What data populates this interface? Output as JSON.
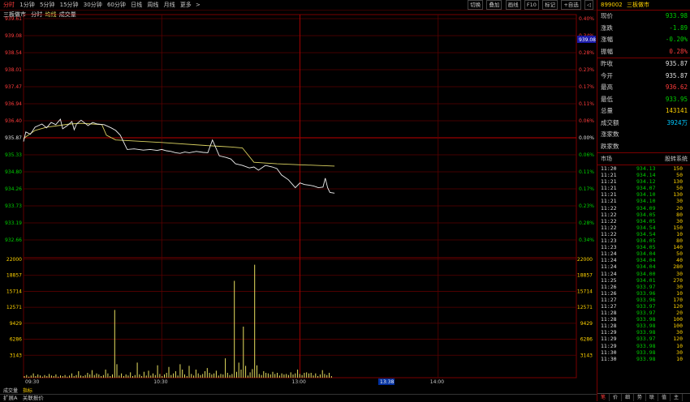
{
  "topbar": {
    "timeframes": [
      "分时",
      "1分钟",
      "5分钟",
      "15分钟",
      "30分钟",
      "60分钟",
      "日线",
      "周线",
      "月线",
      "更多"
    ],
    "active_index": 0,
    "more_arrow": ">",
    "tools": [
      "切换",
      "叠加",
      "画线",
      "F10",
      "标记",
      "+自选",
      "◁"
    ]
  },
  "subbar": {
    "name": "三板做市",
    "mode": "分时",
    "avg_label": "均线",
    "vol_label": "成交量"
  },
  "chart_data": {
    "type": "line",
    "prev_close": 935.87,
    "price_ticks": [
      "939.61",
      "939.08",
      "938.54",
      "938.01",
      "937.47",
      "936.94",
      "936.40",
      "935.87",
      "935.33",
      "934.80",
      "934.26",
      "933.73",
      "933.19",
      "932.66"
    ],
    "pct_ticks": [
      "0.40%",
      "0.34%",
      "0.28%",
      "0.23%",
      "0.17%",
      "0.11%",
      "0.06%",
      "0.00%",
      "0.06%",
      "0.11%",
      "0.17%",
      "0.23%",
      "0.28%",
      "0.34%"
    ],
    "price_ylim": [
      932.66,
      939.61
    ],
    "price_x": [
      0,
      1,
      3,
      5,
      8,
      10,
      12,
      14,
      16,
      17,
      19,
      21,
      22,
      23,
      25,
      28,
      30,
      32,
      35,
      38,
      40,
      42,
      45,
      48,
      50,
      52,
      55,
      58,
      60,
      62,
      64,
      66,
      68,
      70,
      72,
      75,
      78,
      80,
      82,
      85,
      88,
      90,
      92,
      95,
      98,
      100,
      102,
      105,
      108,
      110,
      112,
      115,
      118,
      120,
      122,
      124,
      126,
      128,
      130,
      131,
      132,
      133,
      135
    ],
    "price": [
      935.75,
      936.05,
      935.98,
      936.2,
      936.3,
      936.18,
      936.35,
      936.28,
      936.45,
      936.15,
      936.25,
      936.38,
      936.12,
      936.3,
      936.42,
      936.25,
      936.35,
      936.3,
      936.28,
      936.18,
      936.1,
      935.95,
      935.5,
      935.52,
      935.5,
      935.48,
      935.5,
      935.47,
      935.5,
      935.46,
      935.44,
      935.4,
      935.38,
      935.42,
      935.4,
      935.44,
      935.41,
      935.4,
      935.8,
      935.3,
      935.25,
      935.2,
      935.05,
      935.0,
      934.92,
      934.95,
      934.85,
      935.0,
      934.95,
      934.9,
      934.7,
      934.55,
      934.3,
      934.45,
      934.4,
      934.38,
      934.35,
      934.3,
      934.32,
      934.6,
      934.3,
      934.15,
      934.13
    ],
    "avg_x": [
      0,
      5,
      10,
      15,
      20,
      25,
      30,
      34,
      36,
      40,
      60,
      80,
      85,
      90,
      95,
      100,
      110,
      120,
      135
    ],
    "avg": [
      935.85,
      936.1,
      936.2,
      936.25,
      936.3,
      936.32,
      936.3,
      936.28,
      935.95,
      935.8,
      935.72,
      935.62,
      935.6,
      935.58,
      935.55,
      935.1,
      935.05,
      935.02,
      934.98
    ],
    "vol_ticks": [
      "22000",
      "18857",
      "15714",
      "12571",
      "9429",
      "6286",
      "3143"
    ],
    "vol_ylim": [
      0,
      22000
    ],
    "volume": [
      300,
      500,
      200,
      400,
      800,
      300,
      600,
      400,
      200,
      500,
      300,
      700,
      400,
      300,
      600,
      200,
      400,
      300,
      500,
      200,
      400,
      800,
      300,
      500,
      1200,
      400,
      300,
      500,
      900,
      600,
      1400,
      500,
      800,
      600,
      300,
      500,
      1500,
      800,
      300,
      600,
      12600,
      2500,
      400,
      800,
      300,
      600,
      400,
      1000,
      300,
      500,
      2800,
      600,
      300,
      1100,
      400,
      1300,
      400,
      800,
      500,
      2300,
      700,
      300,
      600,
      900,
      2000,
      500,
      800,
      1200,
      400,
      2500,
      1500,
      600,
      300,
      2200,
      700,
      400,
      1500,
      800,
      500,
      700,
      1200,
      1800,
      900,
      600,
      800,
      1300,
      400,
      700,
      600,
      3600,
      900,
      500,
      700,
      18000,
      1100,
      2800,
      1500,
      9500,
      2200,
      400,
      1000,
      1600,
      21000,
      2300,
      700,
      500,
      1200,
      900,
      800,
      600,
      1100,
      700,
      900,
      400,
      800,
      600,
      700,
      500,
      1000,
      600,
      800,
      1500,
      700,
      500,
      900,
      1000,
      800,
      900,
      400,
      800,
      300,
      600,
      1400,
      700,
      500,
      900,
      300
    ],
    "x_labels": [
      "09:30",
      "10:30",
      "13:00",
      "13:38",
      "14:00"
    ],
    "vol_label": "成交量",
    "indicator_label": "指标"
  },
  "right": {
    "code": "899002",
    "name": "三板做市",
    "rows1": [
      {
        "label": "现价",
        "value": "933.98",
        "color": "#00d000"
      },
      {
        "label": "涨跌",
        "value": "-1.89",
        "color": "#00d000"
      },
      {
        "label": "涨幅",
        "value": "-0.20%",
        "color": "#00d000"
      },
      {
        "label": "振幅",
        "value": "0.28%",
        "color": "#ff3b3b"
      }
    ],
    "rows2": [
      {
        "label": "昨收",
        "value": "935.87",
        "color": "#e0e0e0"
      },
      {
        "label": "今开",
        "value": "935.87",
        "color": "#e0e0e0"
      },
      {
        "label": "最高",
        "value": "936.62",
        "color": "#ff3b3b"
      },
      {
        "label": "最低",
        "value": "933.95",
        "color": "#00d000"
      },
      {
        "label": "总量",
        "value": "143141",
        "color": "#ffd200"
      },
      {
        "label": "成交额",
        "value": "3924万",
        "color": "#00c8ff"
      },
      {
        "label": "涨家数",
        "value": "",
        "color": "#e0e0e0"
      },
      {
        "label": "跌家数",
        "value": "",
        "color": "#e0e0e0"
      }
    ],
    "ticks_head_left": "市场",
    "ticks_head_right": "股转系统",
    "ticks": [
      [
        "11:20",
        "934.13",
        "150"
      ],
      [
        "11:21",
        "934.14",
        "50"
      ],
      [
        "11:21",
        "934.12",
        "130"
      ],
      [
        "11:21",
        "934.07",
        "50"
      ],
      [
        "11:21",
        "934.10",
        "130"
      ],
      [
        "11:21",
        "934.10",
        "30"
      ],
      [
        "11:22",
        "934.09",
        "20"
      ],
      [
        "11:22",
        "934.05",
        "80"
      ],
      [
        "11:22",
        "934.05",
        "30"
      ],
      [
        "11:22",
        "934.54",
        "150"
      ],
      [
        "11:22",
        "934.54",
        "10"
      ],
      [
        "11:23",
        "934.05",
        "80"
      ],
      [
        "11:23",
        "934.05",
        "140"
      ],
      [
        "11:24",
        "934.04",
        "50"
      ],
      [
        "11:24",
        "934.04",
        "40"
      ],
      [
        "11:24",
        "934.04",
        "280"
      ],
      [
        "11:24",
        "934.00",
        "30"
      ],
      [
        "11:25",
        "934.01",
        "270"
      ],
      [
        "11:26",
        "933.97",
        "30"
      ],
      [
        "11:26",
        "933.96",
        "10"
      ],
      [
        "11:27",
        "933.96",
        "170"
      ],
      [
        "11:27",
        "933.97",
        "120"
      ],
      [
        "11:28",
        "933.97",
        "20"
      ],
      [
        "11:28",
        "933.98",
        "100"
      ],
      [
        "11:28",
        "933.98",
        "100"
      ],
      [
        "11:29",
        "933.98",
        "30"
      ],
      [
        "11:29",
        "933.97",
        "120"
      ],
      [
        "11:29",
        "933.98",
        "10"
      ],
      [
        "11:30",
        "933.98",
        "30"
      ],
      [
        "11:30",
        "933.98",
        "10"
      ]
    ],
    "bottom_tabs": [
      "笔",
      "价",
      "细",
      "势",
      "联",
      "值",
      "主"
    ]
  },
  "bottombar": {
    "left": "扩展A",
    "right": "关联报价"
  }
}
